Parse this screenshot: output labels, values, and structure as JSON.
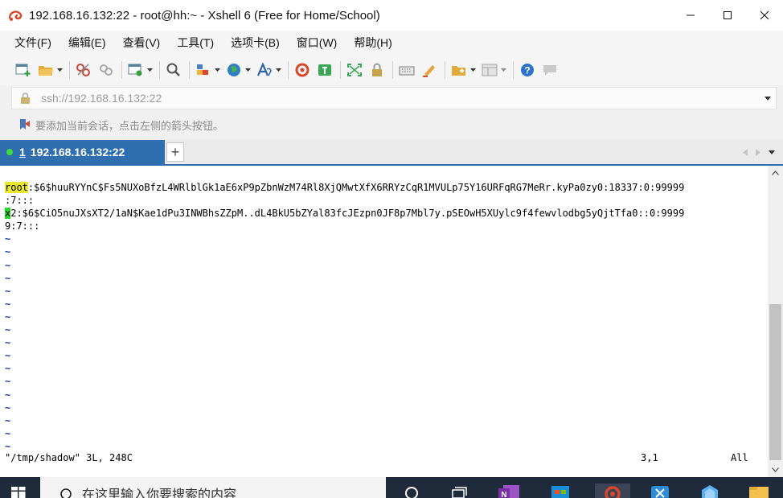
{
  "window": {
    "title": "192.168.16.132:22 - root@hh:~ - Xshell 6 (Free for Home/School)"
  },
  "menu": {
    "items": [
      "文件(F)",
      "编辑(E)",
      "查看(V)",
      "工具(T)",
      "选项卡(B)",
      "窗口(W)",
      "帮助(H)"
    ]
  },
  "address": {
    "value": "ssh://192.168.16.132:22"
  },
  "hint": {
    "text": "要添加当前会话，点击左侧的箭头按钮。"
  },
  "tab": {
    "number": "1",
    "label": "192.168.16.132:22"
  },
  "terminal": {
    "line1_user": "root",
    "line1_rest": ":$6$huuRYYnC$Fs5NUXoBfzL4WRlblGk1aE6xP9pZbnWzM74Rl8XjQMwtXfX6RRYzCqR1MVULp75Y16URFqRG7MeRr.kyPa0zy0:18337:0:99999",
    "line1_wrap": ":7:::",
    "line2_user": "x",
    "line2_rest": "2:$6$CiO5nuJXsXT2/1aN$Kae1dPu3INWBhsZZpM..dL4BkU5bZYal83fcJEzpn0JF8p7Mbl7y.pSEOwH5XUylc9f4fewvlodbg5yQjtTfa0::0:9999",
    "line2_wrap": "9:7:::",
    "tilde": "~",
    "status_file": "\"/tmp/shadow\" 3L, 248C",
    "status_pos": "3,1",
    "status_all": "All"
  },
  "taskbar": {
    "search_placeholder": "在这里输入你要搜索的内容"
  },
  "colors": {
    "tab_active": "#2f6fb0",
    "highlight_root": "#e9e82a",
    "highlight_x": "#2bd62b",
    "tilde": "#1a3ca8"
  }
}
